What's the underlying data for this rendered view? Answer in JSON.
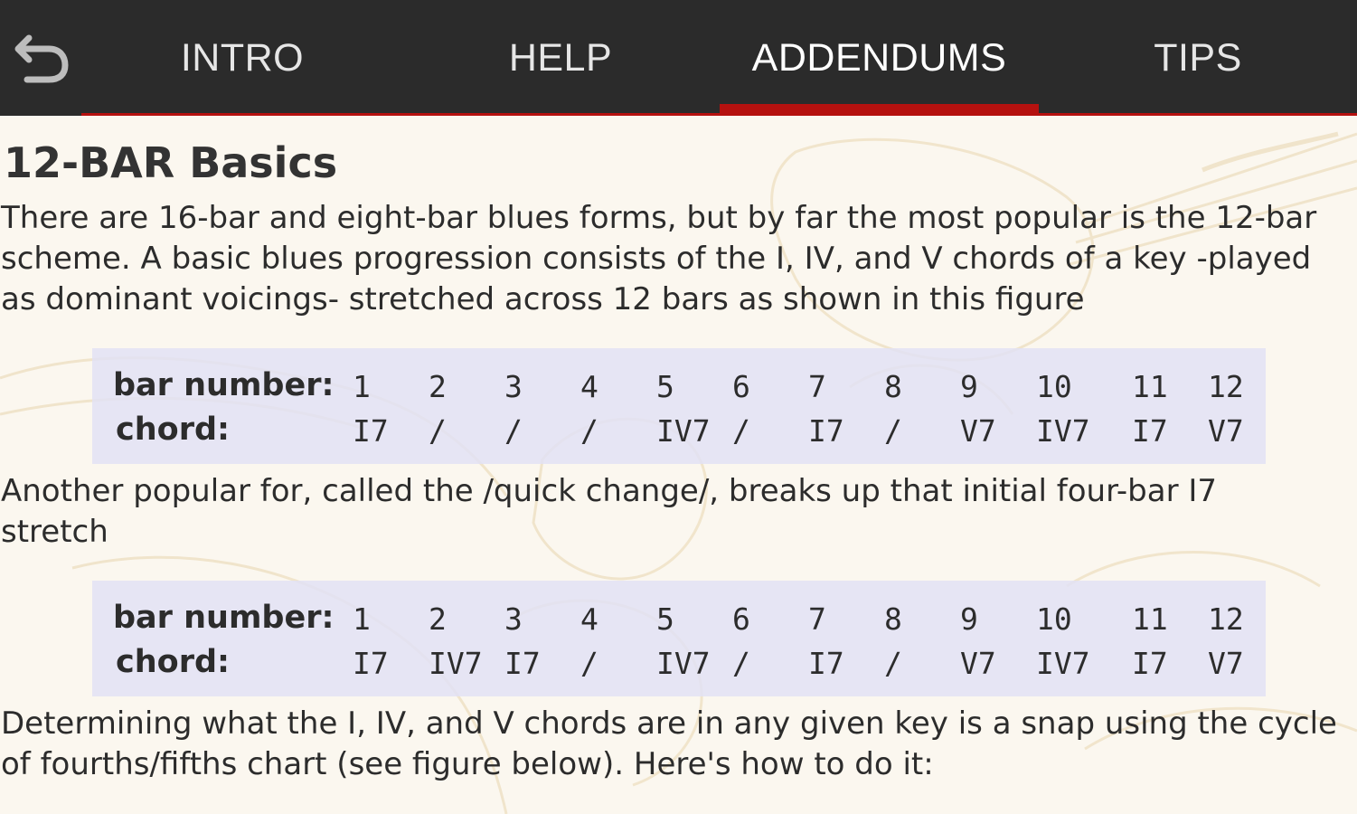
{
  "tabs": [
    "INTRO",
    "HELP",
    "ADDENDUMS",
    "TIPS"
  ],
  "active_tab": "ADDENDUMS",
  "colors": {
    "toolbar": "#2b2b2b",
    "accent": "#b5110f",
    "page_bg": "#fbf7ef",
    "table_bg": "#e2e2f5"
  },
  "icons": {
    "back": "back-arrow-icon"
  },
  "content": {
    "heading": "12-BAR Basics",
    "paragraph1": [
      "There are 16-bar and eight-bar blues forms, but by far the most popular is the 12-bar",
      "scheme. A basic blues progression consists of the I, IV, and V chords of a key -played",
      "as dominant voicings- stretched across 12 bars as shown in this figure"
    ],
    "paragraph2": [
      "Another popular for, called the /quick change/, breaks up that initial four-bar I7",
      "stretch"
    ],
    "paragraph3": [
      "Determining what the I, IV, and V chords are in any given key is a snap using the cycle",
      "of fourths/fifths chart (see figure below). Here's how to do it:"
    ]
  },
  "tables": [
    {
      "bar_label": "bar number:",
      "chord_label": "chord:",
      "bars": [
        "1",
        "2",
        "3",
        "4",
        "5",
        "6",
        "7",
        "8",
        "9",
        "10",
        "11",
        "12"
      ],
      "chords": [
        "I7",
        "/",
        "/",
        "/",
        "IV7",
        "/",
        "I7",
        "/",
        "V7",
        "IV7",
        "I7",
        "V7"
      ]
    },
    {
      "bar_label": "bar number:",
      "chord_label": "chord:",
      "bars": [
        "1",
        "2",
        "3",
        "4",
        "5",
        "6",
        "7",
        "8",
        "9",
        "10",
        "11",
        "12"
      ],
      "chords": [
        "I7",
        "IV7",
        "I7",
        "/",
        "IV7",
        "/",
        "I7",
        "/",
        "V7",
        "IV7",
        "I7",
        "V7"
      ]
    }
  ]
}
